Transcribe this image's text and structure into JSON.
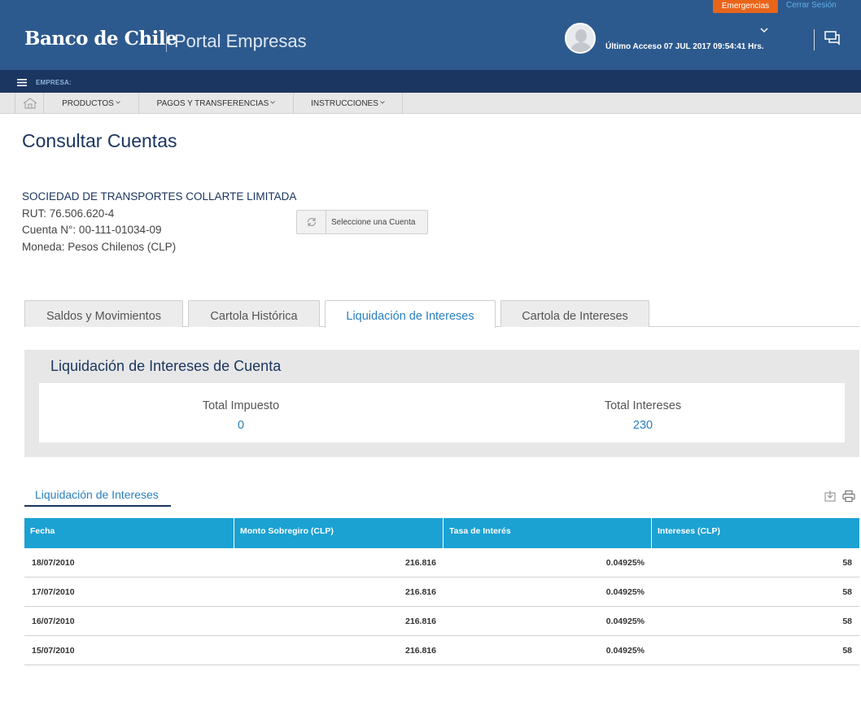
{
  "header": {
    "logo": "Banco de Chile",
    "portal": "Portal Empresas",
    "emergencias": "Emergencias",
    "cerrar_sesion": "Cerrar Sesión",
    "ultimo_acceso": "Último Acceso 07 JUL 2017 09:54:41 Hrs."
  },
  "empresa_bar": {
    "label": "EMPRESA:"
  },
  "nav": {
    "items": [
      {
        "label": "PRODUCTOS"
      },
      {
        "label": "PAGOS Y TRANSFERENCIAS"
      },
      {
        "label": "INSTRUCCIONES"
      }
    ]
  },
  "page": {
    "title": "Consultar Cuentas"
  },
  "account": {
    "company": "SOCIEDAD DE TRANSPORTES COLLARTE LIMITADA",
    "rut": "RUT: 76.506.620-4",
    "cuenta": "Cuenta N°: 00-111-01034-09",
    "moneda": "Moneda: Pesos Chilenos (CLP)",
    "select_button": "Seleccione una Cuenta"
  },
  "tabs": [
    {
      "label": "Saldos y Movimientos",
      "active": false
    },
    {
      "label": "Cartola Histórica",
      "active": false
    },
    {
      "label": "Liquidación de Intereses",
      "active": true
    },
    {
      "label": "Cartola de Intereses",
      "active": false
    }
  ],
  "summary": {
    "title": "Liquidación de Intereses de Cuenta",
    "total_impuesto_label": "Total Impuesto",
    "total_impuesto_value": "0",
    "total_intereses_label": "Total Intereses",
    "total_intereses_value": "230"
  },
  "subtab": {
    "label": "Liquidación de Intereses"
  },
  "table": {
    "columns": [
      "Fecha",
      "Monto Sobregiro (CLP)",
      "Tasa de Interés",
      "Intereses (CLP)"
    ],
    "rows": [
      [
        "18/07/2010",
        "216.816",
        "0.04925%",
        "58"
      ],
      [
        "17/07/2010",
        "216.816",
        "0.04925%",
        "58"
      ],
      [
        "16/07/2010",
        "216.816",
        "0.04925%",
        "58"
      ],
      [
        "15/07/2010",
        "216.816",
        "0.04925%",
        "58"
      ]
    ]
  },
  "colors": {
    "header_bg": "#2d5a8e",
    "empresa_bar_bg": "#1b3661",
    "accent": "#2a7fc0",
    "table_header": "#1ba1d2",
    "emergencias": "#e8651a"
  }
}
